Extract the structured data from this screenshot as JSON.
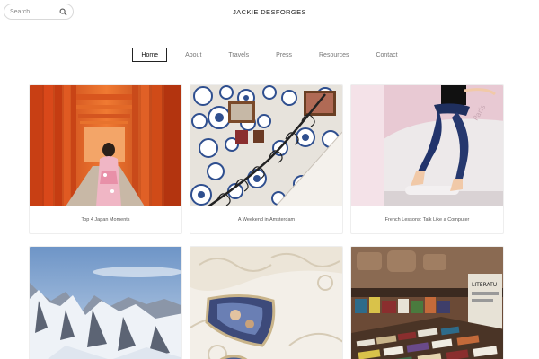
{
  "header": {
    "site_title": "JACKIE DESFORGES",
    "search_placeholder": "Search ..."
  },
  "nav": {
    "items": [
      {
        "label": "Home",
        "active": true
      },
      {
        "label": "About",
        "active": false
      },
      {
        "label": "Travels",
        "active": false
      },
      {
        "label": "Press",
        "active": false
      },
      {
        "label": "Resources",
        "active": false
      },
      {
        "label": "Contact",
        "active": false
      }
    ]
  },
  "posts": [
    {
      "title": "Top 4 Japan Moments",
      "image": "torii-gates-kimono-photo"
    },
    {
      "title": "A Weekend in Amsterdam",
      "image": "decorative-plates-staircase-photo"
    },
    {
      "title": "French Lessons: Talk Like a Computer",
      "image": "jumping-woman-jeans-photo"
    },
    {
      "title": "",
      "image": "snowy-mountains-photo"
    },
    {
      "title": "",
      "image": "ornate-ceiling-painting-photo"
    },
    {
      "title": "",
      "image": "bookstall-books-photo"
    }
  ],
  "colors": {
    "torii_orange": "#e2531c",
    "nav_active_border": "#222222",
    "plate_blue": "#2f4f8f"
  }
}
